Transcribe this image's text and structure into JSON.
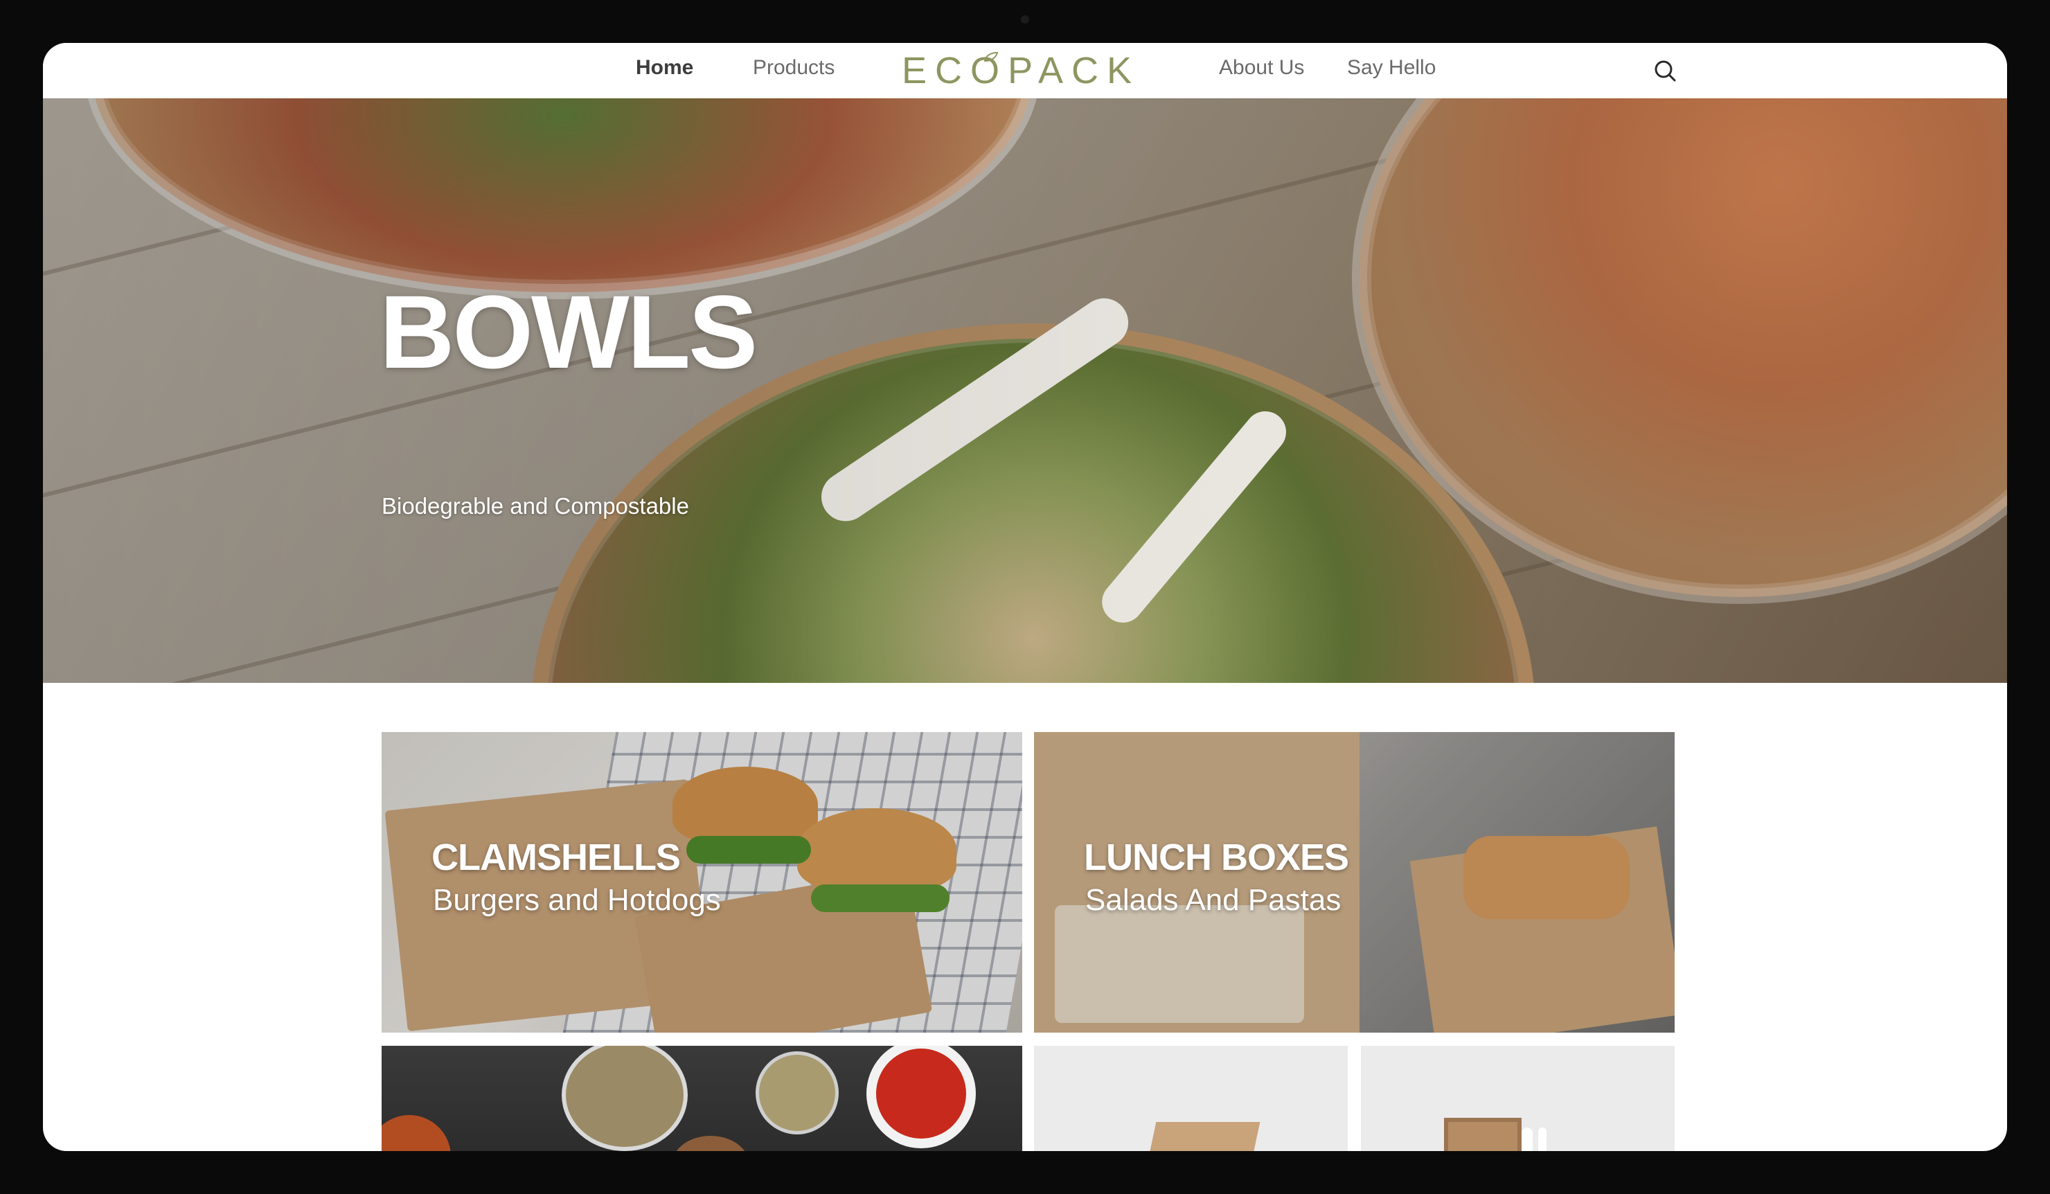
{
  "nav": {
    "home_label": "Home",
    "products_label": "Products",
    "logo_text": "ECOPACK",
    "about_label": "About Us",
    "hello_label": "Say Hello",
    "search_icon": "search-icon"
  },
  "hero": {
    "title": "BOWLS",
    "subtitle": "Biodegrable and Compostable"
  },
  "tiles": [
    {
      "title": "CLAMSHELLS",
      "subtitle": "Burgers and Hotdogs"
    },
    {
      "title": "LUNCH BOXES",
      "subtitle": "Salads And Pastas"
    }
  ],
  "colors": {
    "logo": "#8e9560",
    "nav_text": "#6a6a6a",
    "nav_active": "#3d3d3d",
    "kraft": "#c49a6c"
  }
}
